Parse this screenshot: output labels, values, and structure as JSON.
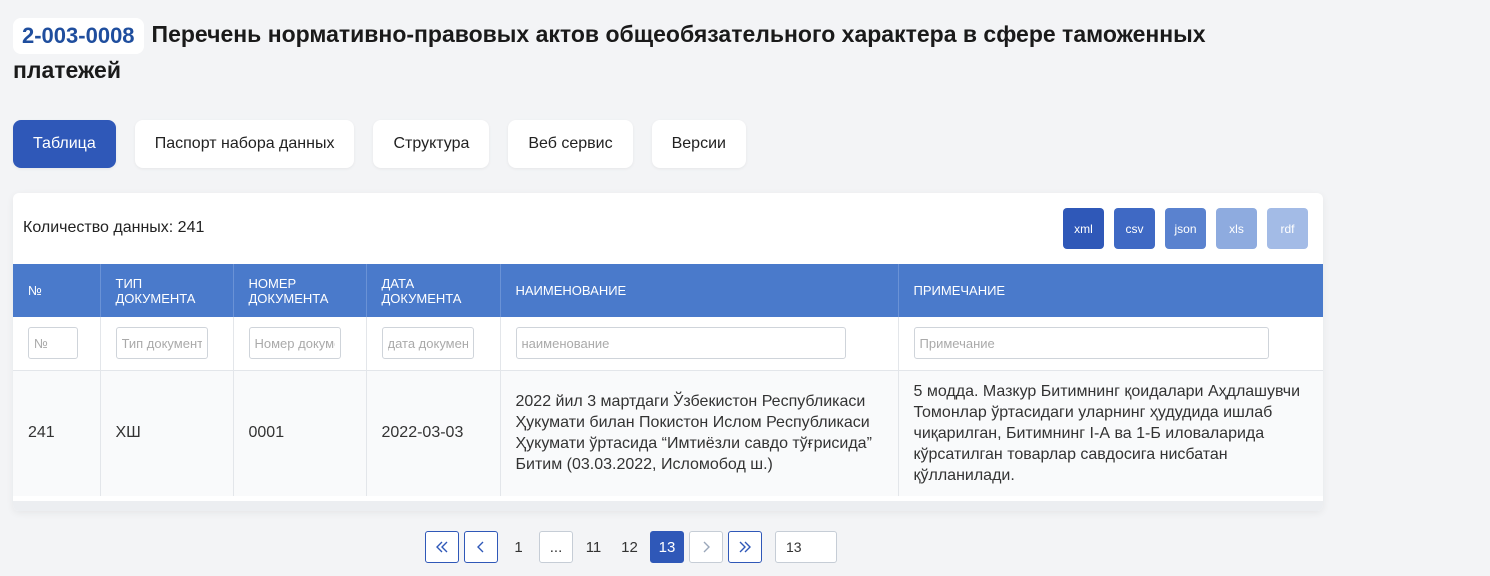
{
  "header": {
    "code": "2-003-0008",
    "title": "Перечень нормативно-правовых актов общеобязательного характера в сфере таможенных платежей"
  },
  "tabs": [
    {
      "label": "Таблица",
      "active": true
    },
    {
      "label": "Паспорт набора данных",
      "active": false
    },
    {
      "label": "Структура",
      "active": false
    },
    {
      "label": "Веб сервис",
      "active": false
    },
    {
      "label": "Версии",
      "active": false
    }
  ],
  "card": {
    "count_label": "Количество данных: 241",
    "exports": [
      {
        "label": "xml",
        "color": "#2f58b8"
      },
      {
        "label": "csv",
        "color": "#3f69c4"
      },
      {
        "label": "json",
        "color": "#5a82cf"
      },
      {
        "label": "xls",
        "color": "#8eabdf"
      },
      {
        "label": "rdf",
        "color": "#a3bbe6"
      }
    ]
  },
  "table": {
    "header_color": "#4a7acb",
    "columns": [
      "№",
      "ТИП ДОКУМЕНТА",
      "НОМЕР ДОКУМЕНТА",
      "ДАТА ДОКУМЕНТА",
      "НАИМЕНОВАНИЕ",
      "ПРИМЕЧАНИЕ"
    ],
    "filters": [
      "№",
      "Тип документа",
      "Номер документа",
      "дата документа",
      "наименование",
      "Примечание"
    ],
    "rows": [
      {
        "num": "241",
        "type": "ХШ",
        "number": "0001",
        "date": "2022-03-03",
        "name": "2022 йил 3 мартдаги Ўзбекистон Республикаси Ҳукумати билан Покистон Ислом Республикаси Ҳукумати ўртасида “Имтиёзли савдо тўғрисида” Битим (03.03.2022, Исломобод ш.)",
        "note": "5 модда. Мазкур Битимнинг қоидалари Аҳдлашувчи Томонлар ўртасидаги уларнинг ҳудудида ишлаб чиқарилган, Битимнинг I-А ва 1-Б иловаларида кўрсатилган товарлар савдосига нисбатан қўлланилади."
      }
    ]
  },
  "pagination": {
    "pages": [
      "1",
      "...",
      "11",
      "12",
      "13"
    ],
    "current": "13",
    "goto_value": "13",
    "first_icon": "double-chevron-left-icon",
    "prev_icon": "chevron-left-icon",
    "next_icon": "chevron-right-icon",
    "last_icon": "double-chevron-right-icon"
  },
  "colors": {
    "accent": "#2f58b8",
    "background": "#f3f4f6"
  }
}
